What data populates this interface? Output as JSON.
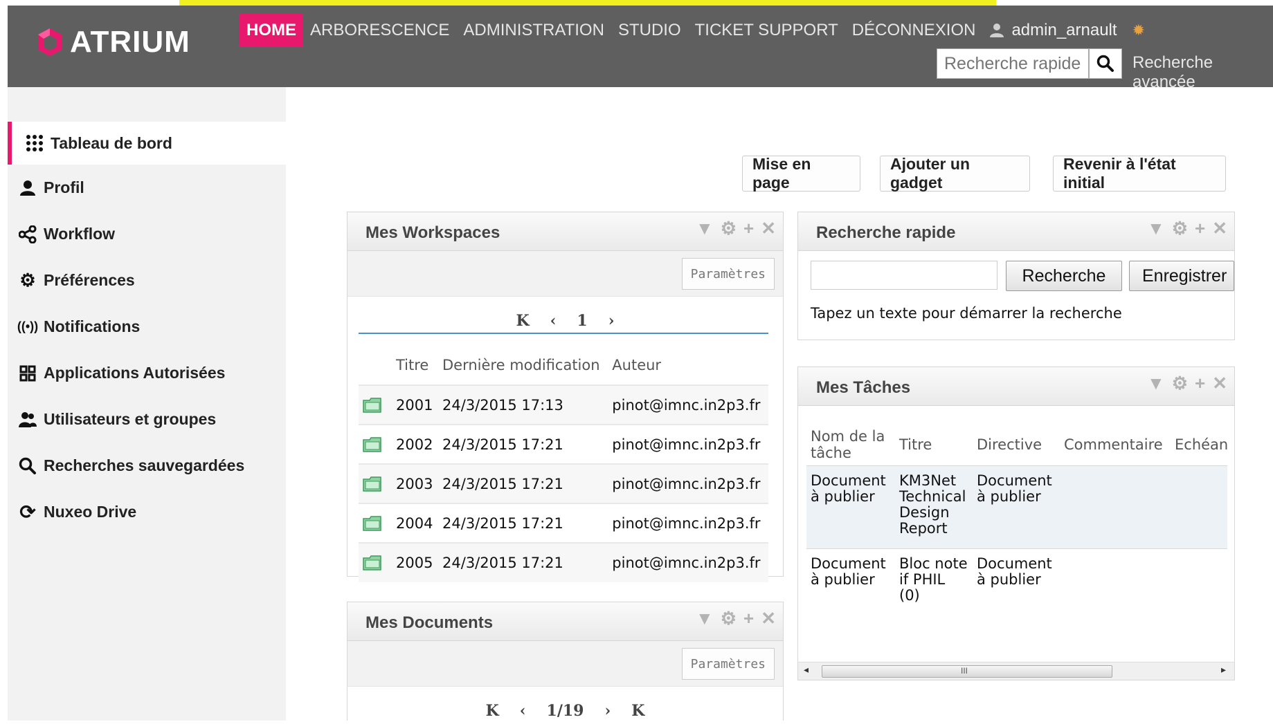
{
  "header": {
    "logo_text": "ATRIUM",
    "nav": [
      "HOME",
      "ARBORESCENCE",
      "ADMINISTRATION",
      "STUDIO",
      "TICKET SUPPORT",
      "DÉCONNEXION"
    ],
    "username": "admin_arnault",
    "search_placeholder": "Recherche rapide",
    "advanced_search": "Recherche avancée",
    "accent_color": "#e8186d"
  },
  "sidebar": {
    "items": [
      {
        "label": "Tableau de bord",
        "icon": "grid-icon"
      },
      {
        "label": "Profil",
        "icon": "user-icon"
      },
      {
        "label": "Workflow",
        "icon": "share-icon"
      },
      {
        "label": "Préférences",
        "icon": "gear-icon"
      },
      {
        "label": "Notifications",
        "icon": "broadcast-icon"
      },
      {
        "label": "Applications Autorisées",
        "icon": "apps-icon"
      },
      {
        "label": "Utilisateurs et groupes",
        "icon": "users-icon"
      },
      {
        "label": "Recherches sauvegardées",
        "icon": "search-icon"
      },
      {
        "label": "Nuxeo Drive",
        "icon": "refresh-icon"
      }
    ]
  },
  "toolbar": {
    "layout": "Mise en page",
    "add_gadget": "Ajouter un gadget",
    "reset": "Revenir à l'état initial"
  },
  "gadget_controls": [
    "▼",
    "⚙",
    "+",
    "✕"
  ],
  "workspaces": {
    "title": "Mes Workspaces",
    "params": "Paramètres",
    "pager": {
      "first": "K",
      "prev": "‹",
      "page": "1",
      "next": "›"
    },
    "columns": [
      "Titre",
      "Dernière modification",
      "Auteur"
    ],
    "rows": [
      {
        "title": "2001",
        "modified": "24/3/2015 17:13",
        "author": "pinot@imnc.in2p3.fr"
      },
      {
        "title": "2002",
        "modified": "24/3/2015 17:21",
        "author": "pinot@imnc.in2p3.fr"
      },
      {
        "title": "2003",
        "modified": "24/3/2015 17:21",
        "author": "pinot@imnc.in2p3.fr"
      },
      {
        "title": "2004",
        "modified": "24/3/2015 17:21",
        "author": "pinot@imnc.in2p3.fr"
      },
      {
        "title": "2005",
        "modified": "24/3/2015 17:21",
        "author": "pinot@imnc.in2p3.fr"
      }
    ]
  },
  "documents": {
    "title": "Mes Documents",
    "params": "Paramètres",
    "pager": {
      "first": "K",
      "prev": "‹",
      "page": "1/19",
      "next": "›",
      "last": "K"
    }
  },
  "quick_search": {
    "title": "Recherche rapide",
    "search_btn": "Recherche",
    "save_btn": "Enregistrer",
    "help": "Tapez un texte pour démarrer la recherche"
  },
  "tasks": {
    "title": "Mes Tâches",
    "columns": [
      "Nom de la tâche",
      "Titre",
      "Directive",
      "Commentaire",
      "Echéan"
    ],
    "rows": [
      {
        "name": "Document à publier",
        "title": "KM3Net Technical Design Report",
        "directive": "Document à publier"
      },
      {
        "name": "Document à publier",
        "title": "Bloc note if PHIL (0)",
        "directive": "Document à publier"
      }
    ],
    "scroll_mark": "III"
  }
}
